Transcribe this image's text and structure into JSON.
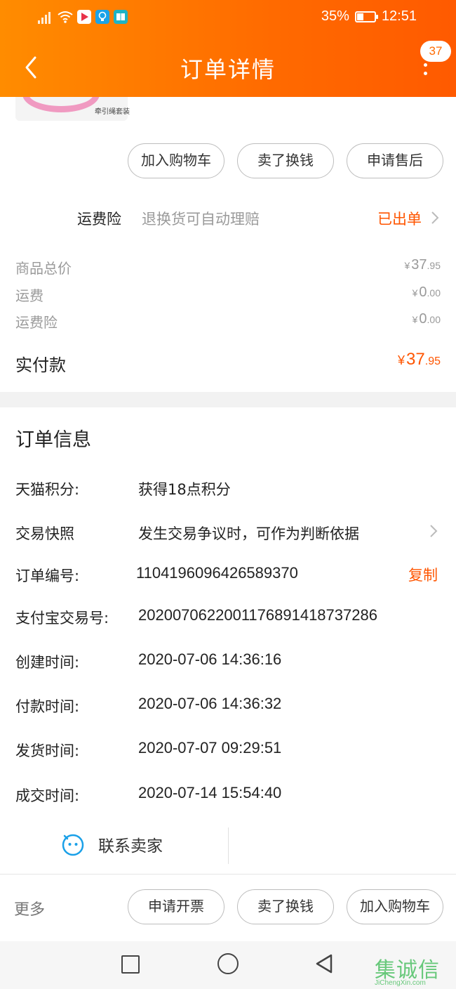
{
  "status_bar": {
    "battery": "35%",
    "battery_fraction": 0.35,
    "time": "12:51"
  },
  "header": {
    "title": "订单详情",
    "badge_count": "37"
  },
  "product": {
    "caption": "牵引绳套装"
  },
  "actions_top": [
    "加入购物车",
    "卖了换钱",
    "申请售后"
  ],
  "insurance": {
    "label": "运费险",
    "desc": "退换货可自动理赔",
    "status": "已出单"
  },
  "fees": [
    {
      "label": "商品总价",
      "currency": "¥",
      "int": "37",
      "dec": ".95"
    },
    {
      "label": "运费",
      "currency": "¥",
      "int": "0",
      "dec": ".00"
    },
    {
      "label": "运费险",
      "currency": "¥",
      "int": "0",
      "dec": ".00"
    }
  ],
  "paid": {
    "label": "实付款",
    "currency": "¥",
    "int": "37",
    "dec": ".95"
  },
  "order_info": {
    "title": "订单信息",
    "points_label": "天猫积分:",
    "points_value": "获得18点积分",
    "snapshot_label": "交易快照",
    "snapshot_value": "发生交易争议时，可作为判断依据",
    "order_no_label": "订单编号:",
    "order_no_value": "1104196096426589370",
    "copy_label": "复制",
    "alipay_label": "支付宝交易号:",
    "alipay_value": "2020070622001176891418737286",
    "created_label": "创建时间:",
    "created_value": "2020-07-06 14:36:16",
    "paid_label": "付款时间:",
    "paid_value": "2020-07-06 14:36:32",
    "shipped_label": "发货时间:",
    "shipped_value": "2020-07-07 09:29:51",
    "closed_label": "成交时间:",
    "closed_value": "2020-07-14 15:54:40"
  },
  "contact": {
    "label": "联系卖家"
  },
  "bottom_bar": {
    "more": "更多",
    "buttons": [
      "申请开票",
      "卖了换钱",
      "加入购物车"
    ]
  },
  "watermark": {
    "chars": "集诚信",
    "url": "JiChengXin.com"
  }
}
